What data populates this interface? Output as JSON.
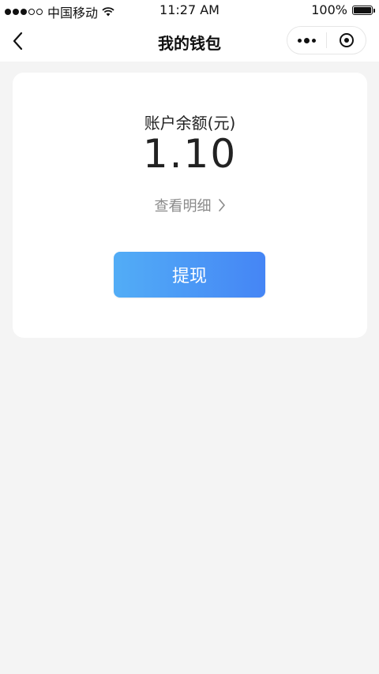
{
  "status_bar": {
    "carrier": "中国移动",
    "time": "11:27 AM",
    "battery_percent": "100%"
  },
  "nav": {
    "title": "我的钱包",
    "back_icon": "chevron-left-icon",
    "more_icon": "more-dots-icon",
    "close_icon": "target-circle-icon"
  },
  "wallet": {
    "balance_label": "账户余额(元)",
    "balance_amount": "1.10",
    "details_link": "查看明细",
    "withdraw_button": "提现"
  },
  "colors": {
    "page_background": "#f4f4f4",
    "card_background": "#ffffff",
    "button_gradient_start": "#52adf6",
    "button_gradient_end": "#4585f5",
    "muted_text": "#8a8a8a"
  }
}
